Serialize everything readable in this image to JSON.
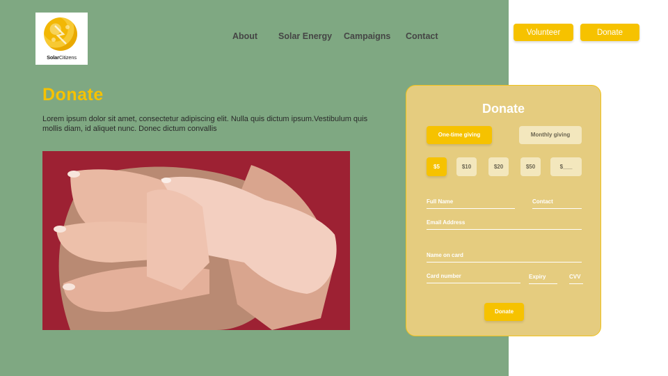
{
  "brand": {
    "name_bold": "Solar",
    "name_rest": "Citizens",
    "logo_icon": "sun-logo-icon"
  },
  "nav": {
    "items": [
      "About",
      "Solar Energy",
      "Campaigns",
      "Contact"
    ]
  },
  "header_buttons": {
    "volunteer": "Volunteer",
    "donate": "Donate"
  },
  "main": {
    "title": "Donate",
    "lead": "Lorem ipsum dolor sit amet, consectetur adipiscing elit. Nulla quis dictum ipsum.Vestibulum quis mollis diam, id aliquet nunc. Donec dictum convallis"
  },
  "donation_form": {
    "title": "Donate",
    "frequency": {
      "one_time": "One-time giving",
      "monthly": "Monthly giving",
      "selected": "One-time giving"
    },
    "amounts": [
      "$5",
      "$10",
      "$20",
      "$50"
    ],
    "selected_amount": "$5",
    "custom_amount_placeholder": "$___",
    "fields": {
      "full_name": "Full Name",
      "contact": "Contact",
      "email": "Email Address",
      "name_on_card": "Name on card",
      "card_number": "Card number",
      "expiry": "Expiry",
      "cvv": "CVV"
    },
    "submit_label": "Donate"
  },
  "colors": {
    "green_panel": "#7fa882",
    "accent_yellow": "#f6c200",
    "card_bg": "#e5cc7f",
    "photo_bg": "#8f1c2d"
  }
}
